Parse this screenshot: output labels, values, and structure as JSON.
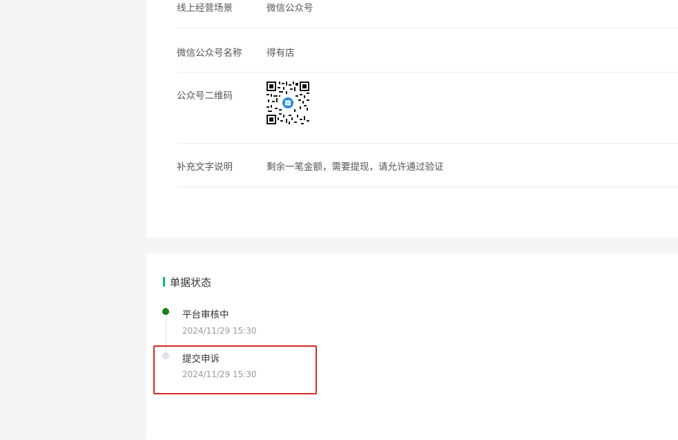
{
  "info": {
    "rows": [
      {
        "label": "线上经营场景",
        "value": "微信公众号"
      },
      {
        "label": "微信公众号名称",
        "value": "得有店"
      },
      {
        "label": "公众号二维码"
      },
      {
        "label": "补充文字说明",
        "value": "剩余一笔金额，需要提现，请允许通过验证"
      }
    ]
  },
  "status": {
    "title": "单据状态",
    "steps": [
      {
        "title": "平台审核中",
        "time": "2024/11/29 15:30"
      },
      {
        "title": "提交申诉",
        "time": "2024/11/29 15:30"
      }
    ]
  },
  "colors": {
    "accent": "#07c160",
    "active_dot": "#1a7f1a",
    "inactive_dot": "#dfe2ea",
    "highlight": "#d9281f"
  }
}
